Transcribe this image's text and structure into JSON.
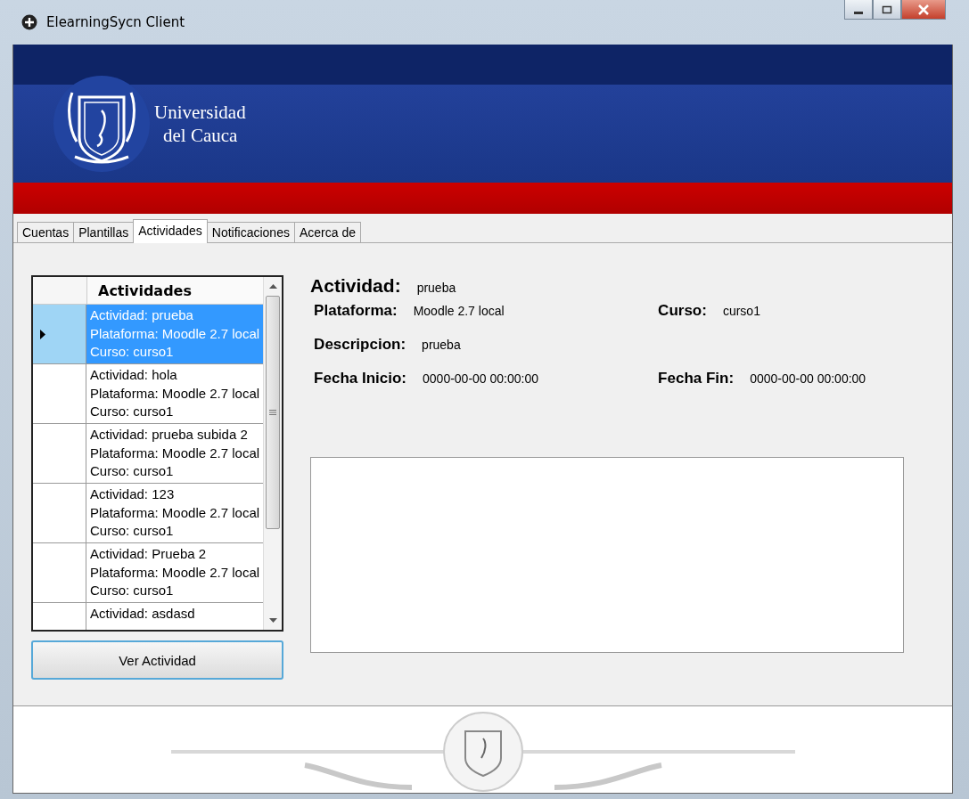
{
  "window": {
    "title": "ElearningSycn Client"
  },
  "banner": {
    "name_lines": [
      "Universidad",
      "del Cauca"
    ]
  },
  "tabs": [
    {
      "label": "Cuentas",
      "selected": false
    },
    {
      "label": "Plantillas",
      "selected": false
    },
    {
      "label": "Actividades",
      "selected": true
    },
    {
      "label": "Notificaciones",
      "selected": false
    },
    {
      "label": "Acerca de",
      "selected": false
    }
  ],
  "grid": {
    "column": "Actividades",
    "rows": [
      {
        "lines": [
          "Actividad: prueba",
          "Plataforma: Moodle 2.7 local",
          "Curso: curso1"
        ],
        "selected": true
      },
      {
        "lines": [
          "Actividad: hola",
          "Plataforma: Moodle 2.7 local",
          "Curso: curso1"
        ],
        "selected": false
      },
      {
        "lines": [
          "Actividad: prueba subida 2",
          "Plataforma: Moodle 2.7 local",
          "Curso: curso1"
        ],
        "selected": false
      },
      {
        "lines": [
          "Actividad: 123",
          "Plataforma: Moodle 2.7 local",
          "Curso: curso1"
        ],
        "selected": false
      },
      {
        "lines": [
          "Actividad: Prueba 2",
          "Plataforma: Moodle 2.7 local",
          "Curso: curso1"
        ],
        "selected": false
      },
      {
        "lines": [
          "Actividad: asdasd"
        ],
        "selected": false
      }
    ]
  },
  "view_button": "Ver Actividad",
  "details": {
    "title": {
      "label": "Actividad:",
      "value": "prueba"
    },
    "rows": [
      [
        {
          "label": "Plataforma:",
          "value": "Moodle 2.7 local"
        },
        {
          "label": "Curso:",
          "value": "curso1"
        }
      ],
      [
        {
          "label": "Descripcion:",
          "value": "prueba"
        }
      ],
      [
        {
          "label": "Fecha Inicio:",
          "value": "0000-00-00 00:00:00"
        },
        {
          "label": "Fecha Fin:",
          "value": "0000-00-00 00:00:00"
        }
      ]
    ]
  }
}
